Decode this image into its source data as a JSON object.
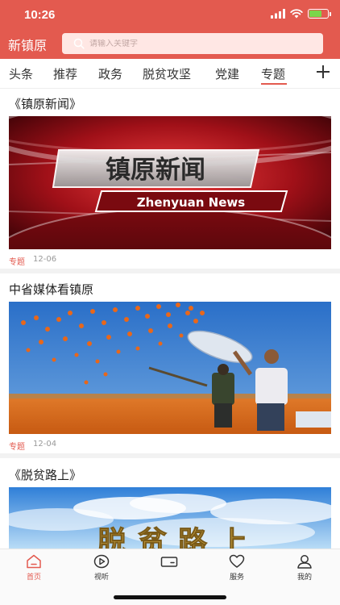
{
  "status_bar": {
    "time": "10:26",
    "battery_color": "#7bd64a",
    "battery_level": 0.7
  },
  "header": {
    "app_title": "新镇原",
    "search_placeholder": "请输入关键字",
    "background": "#e35a4f"
  },
  "tabs": [
    {
      "label": "头条",
      "active": false
    },
    {
      "label": "推荐",
      "active": false
    },
    {
      "label": "政务",
      "active": false
    },
    {
      "label": "脱贫攻坚",
      "active": false
    },
    {
      "label": "党建",
      "active": false
    },
    {
      "label": "专题",
      "active": true
    }
  ],
  "feed": [
    {
      "title": "《镇原新闻》",
      "image": {
        "headline": "镇原新闻",
        "subtitle": "Zhenyuan News"
      },
      "tag": "专题",
      "date": "12-06"
    },
    {
      "title": "中省媒体看镇原",
      "tag": "专题",
      "date": "12-04"
    },
    {
      "title": "《脱贫路上》",
      "image": {
        "headline": "脱贫路上"
      }
    }
  ],
  "bottom_nav": [
    {
      "label": "首页",
      "icon": "home-icon",
      "active": true
    },
    {
      "label": "视听",
      "icon": "play-icon",
      "active": false
    },
    {
      "label": "",
      "icon": "video-icon",
      "active": false
    },
    {
      "label": "服务",
      "icon": "heart-icon",
      "active": false
    },
    {
      "label": "我的",
      "icon": "user-icon",
      "active": false
    }
  ],
  "colors": {
    "accent": "#e35a4f",
    "text": "#222222",
    "meta": "#999999"
  }
}
